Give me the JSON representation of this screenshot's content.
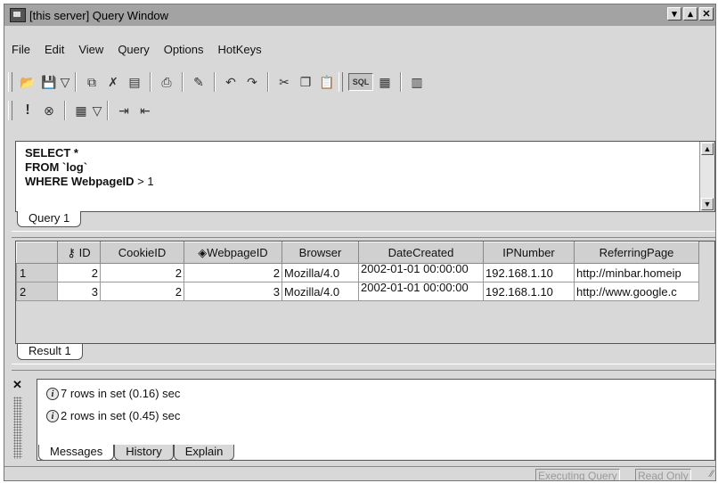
{
  "window": {
    "title": "[this server] Query Window",
    "controls": {
      "minimize": "▾",
      "restore": "▴",
      "close": "✕"
    }
  },
  "menu": [
    "File",
    "Edit",
    "View",
    "Query",
    "Options",
    "HotKeys"
  ],
  "toolbar1": {
    "icons": [
      "open-icon",
      "save-icon",
      "dropdown-arrow-icon",
      "copy-results-icon",
      "delete-icon",
      "print-preview-icon",
      "print-icon",
      "wand-icon",
      "undo-icon",
      "redo-icon",
      "cut-icon",
      "copy-icon",
      "paste-icon",
      "sql-mode-icon",
      "grid-mode-icon",
      "options-icon"
    ],
    "sql_label": "SQL"
  },
  "toolbar2": {
    "icons": [
      "execute-icon",
      "stop-icon",
      "results-grid-icon",
      "dropdown-arrow-icon",
      "indent-icon",
      "outdent-icon"
    ],
    "execute_label": "!"
  },
  "editor": {
    "lines": [
      {
        "keyword": "SELECT",
        "rest": " *"
      },
      {
        "keyword": "FROM",
        "rest": " `log`"
      },
      {
        "keyword": "WHERE",
        "rest_bold": " WebpageID",
        "rest": " > 1"
      }
    ],
    "tab": "Query 1"
  },
  "results": {
    "columns": [
      "ID",
      "CookieID",
      "WebpageID",
      "Browser",
      "DateCreated",
      "IPNumber",
      "ReferringPage"
    ],
    "rows": [
      {
        "row": "1",
        "ID": "2",
        "CookieID": "2",
        "WebpageID": "2",
        "Browser": "Mozilla/4.0",
        "DateCreated": "2002-01-01 00:00:00",
        "IPNumber": "192.168.1.10",
        "ReferringPage": "http://minbar.homeip"
      },
      {
        "row": "2",
        "ID": "3",
        "CookieID": "2",
        "WebpageID": "3",
        "Browser": "Mozilla/4.0",
        "DateCreated": "2002-01-01 00:00:00",
        "IPNumber": "192.168.1.10",
        "ReferringPage": "http://www.google.c"
      }
    ],
    "tab": "Result 1"
  },
  "messages": {
    "items": [
      "7 rows in set (0.16) sec",
      "2 rows in set (0.45) sec"
    ],
    "tabs": [
      "Messages",
      "History",
      "Explain"
    ],
    "close": "✕"
  },
  "status": {
    "executing": "Executing Query",
    "readonly": "Read Only"
  }
}
